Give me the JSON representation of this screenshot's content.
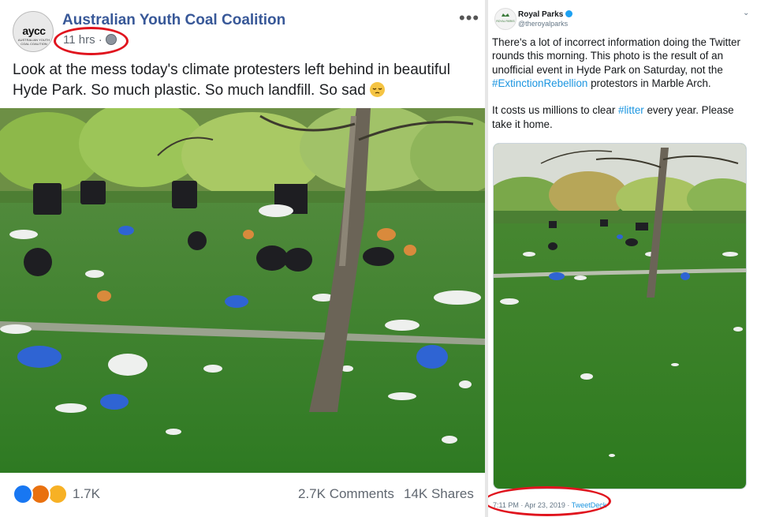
{
  "facebook_post": {
    "page_name": "Australian Youth Coal Coalition",
    "avatar_text": "aycc",
    "avatar_subtext": "AUSTRALIAN YOUTH COAL COALITION",
    "time": "11 hrs ·",
    "more_label": "•••",
    "text": "Look at the mess today's climate protesters left behind in beautiful Hyde Park. So much plastic. So much landfill. So sad",
    "reaction_count": "1.7K",
    "comments": "2.7K Comments",
    "shares": "14K Shares",
    "icons": [
      "like-reaction-icon",
      "angry-reaction-icon",
      "haha-reaction-icon",
      "globe-icon",
      "sad-emoji-icon"
    ]
  },
  "tweet": {
    "name": "Royal Parks",
    "handle": "@theroyalparks",
    "avatar_text": "ROYAL PARKS",
    "text_part1": "There's a lot of incorrect information doing the Twitter rounds this morning. This photo is the result of an unofficial event in Hyde Park on Saturday, not the ",
    "hashtag1": "#ExtinctionRebellion",
    "text_part2": " protestors in Marble Arch.",
    "text_part3": "It costs us millions to clear ",
    "hashtag2": "#litter",
    "text_part4": " every year. Please take it home.",
    "timestamp": "7:11 PM · Apr 23, 2019 ·",
    "source": "TweetDeck",
    "icons": [
      "verified-badge-icon",
      "chevron-down-icon"
    ]
  },
  "colors": {
    "facebook_name": "#385898",
    "twitter_link": "#1b95e0",
    "highlight_circle": "#e0141e",
    "grass": "#3f8a2b"
  }
}
